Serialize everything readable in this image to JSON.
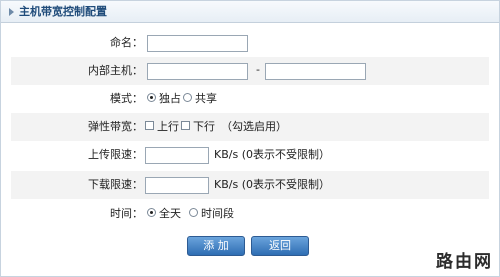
{
  "header": {
    "title": "主机带宽控制配置"
  },
  "form": {
    "name": {
      "label": "命名：",
      "value": ""
    },
    "inner_host": {
      "label": "内部主机：",
      "from_value": "",
      "separator": "-",
      "to_value": ""
    },
    "mode": {
      "label": "模式：",
      "options": [
        {
          "label": "独占",
          "checked": true
        },
        {
          "label": "共享",
          "checked": false
        }
      ]
    },
    "elastic": {
      "label": "弹性带宽：",
      "options": [
        {
          "label": "上行",
          "checked": false
        },
        {
          "label": "下行",
          "checked": false
        }
      ],
      "hint": "（勾选启用）"
    },
    "upload": {
      "label": "上传限速：",
      "value": "",
      "unit_hint": "KB/s (0表示不受限制）"
    },
    "download": {
      "label": "下载限速：",
      "value": "",
      "unit_hint": "KB/s (0表示不受限制）"
    },
    "time": {
      "label": "时间：",
      "options": [
        {
          "label": "全天",
          "checked": true
        },
        {
          "label": "时间段",
          "checked": false
        }
      ]
    }
  },
  "buttons": {
    "add": "添 加",
    "back": "返回"
  },
  "watermark": "路由网"
}
